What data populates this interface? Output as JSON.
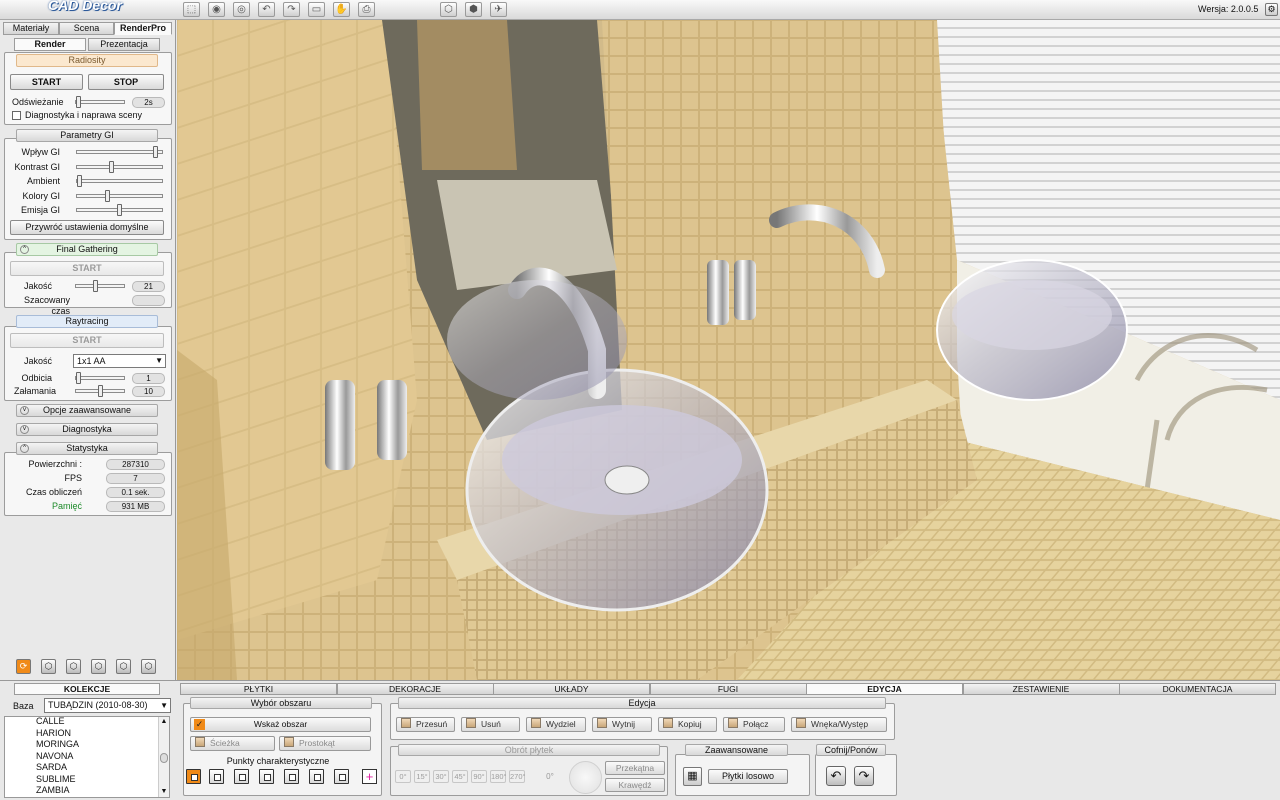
{
  "app": {
    "logo": "CAD Decor",
    "version": "Wersja: 2.0.0.5"
  },
  "toolbar": {
    "icons": [
      "pointer-tool",
      "orbit-view",
      "eye-view",
      "undo",
      "redo",
      "render-frame",
      "walk-tool",
      "print",
      "cube-view-a",
      "cube-view-b",
      "send"
    ]
  },
  "left_tabs": [
    "Materiały",
    "Scena",
    "RenderPro"
  ],
  "sub_tabs": [
    "Render",
    "Prezentacja"
  ],
  "radiosity": {
    "title": "Radiosity",
    "start": "START",
    "stop": "STOP",
    "refresh_label": "Odświeżanie",
    "refresh_value": "2s",
    "refresh_level": 0.0,
    "diag_label": "Diagnostyka i naprawa sceny"
  },
  "gi": {
    "title": "Parametry GI",
    "sliders": [
      {
        "label": "Wpływ GI",
        "level": 0.95
      },
      {
        "label": "Kontrast GI",
        "level": 0.4
      },
      {
        "label": "Ambient",
        "level": 0.0
      },
      {
        "label": "Kolory GI",
        "level": 0.35
      },
      {
        "label": "Emisja GI",
        "level": 0.5
      }
    ],
    "reset": "Przywróć ustawienia domyślne"
  },
  "final_gathering": {
    "title": "Final Gathering",
    "start": "START",
    "quality_label": "Jakość",
    "quality_value": "21",
    "quality_level": 0.4,
    "time_label": "Szacowany czas",
    "time_value": ""
  },
  "raytracing": {
    "title": "Raytracing",
    "start": "START",
    "quality_label": "Jakość",
    "quality_value": "1x1 AA",
    "reflections_label": "Odbicia",
    "reflections_value": "1",
    "reflections_level": 0.0,
    "refractions_label": "Załamania",
    "refractions_value": "10",
    "refractions_level": 0.5
  },
  "advanced": {
    "title": "Opcje zaawansowane"
  },
  "diagnostics": {
    "title": "Diagnostyka"
  },
  "stats": {
    "title": "Statystyka",
    "rows": [
      {
        "label": "Powierzchni :",
        "value": "287310"
      },
      {
        "label": "FPS",
        "value": "7"
      },
      {
        "label": "Czas obliczeń",
        "value": "0.1 sek."
      },
      {
        "label": "Pamięć",
        "value": "931 MB"
      }
    ]
  },
  "bottom_tabs": [
    "PŁYTKI",
    "DEKORACJE",
    "UKŁADY",
    "FUGI",
    "EDYCJA",
    "ZESTAWIENIE",
    "DOKUMENTACJA"
  ],
  "bottom_active_tab": "EDYCJA",
  "collections": {
    "tab": "KOLEKCJE",
    "base_label": "Baza",
    "base_value": "TUBĄDZIN (2010-08-30)",
    "items": [
      "CALLE",
      "HARION",
      "MORINGA",
      "NAVONA",
      "SARDA",
      "SUBLIME",
      "ZAMBIA"
    ]
  },
  "area": {
    "title": "Wybór obszaru",
    "show": "Wskaż obszar",
    "path": "Ścieżka",
    "rect": "Prostokąt",
    "points_title": "Punkty charakterystyczne"
  },
  "edit": {
    "title": "Edycja",
    "buttons": [
      "Przesuń",
      "Usuń",
      "Wydziel",
      "Wytnij",
      "Kopiuj",
      "Połącz",
      "Wnęka/Występ"
    ]
  },
  "rotate": {
    "title": "Obrót płytek",
    "angles": [
      "0°",
      "15°",
      "30°",
      "45°",
      "90°",
      "180°",
      "270°"
    ],
    "current": "0°",
    "diagonal": "Przekątna",
    "edge": "Krawędź"
  },
  "advanced_bottom": {
    "title": "Zaawansowane",
    "random": "Płytki losowo"
  },
  "undo_redo": {
    "title": "Cofnij/Ponów"
  },
  "colors": {
    "accent": "#f08a18",
    "green_header": "#e4f4e2",
    "blue_header": "#e2ecf8",
    "orange_header": "#fbe8cf",
    "tile": "#dcc38c"
  }
}
